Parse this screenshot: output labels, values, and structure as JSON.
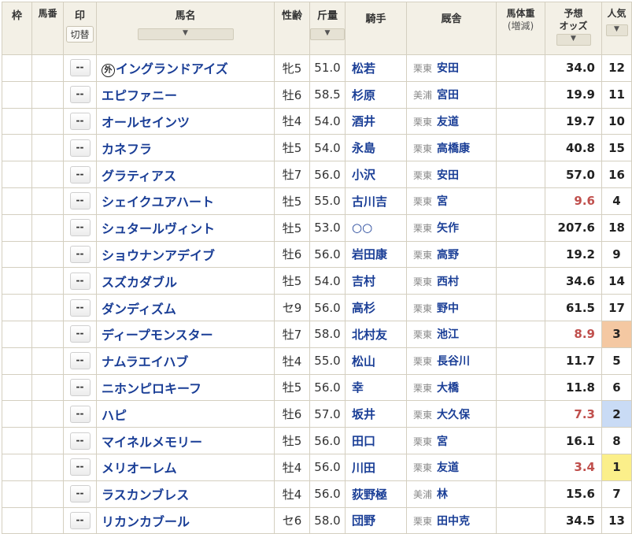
{
  "header": {
    "waku": "枠",
    "umaban": "馬番",
    "mark": "印",
    "mark_toggle": "切替",
    "horse_name": "馬名",
    "sex_age": "性齢",
    "weight": "斤量",
    "jockey": "騎手",
    "stable": "厩舎",
    "body_weight": "馬体重",
    "body_weight_sub": "(増減)",
    "odds_line1": "予想",
    "odds_line2": "オッズ",
    "popularity": "人気",
    "sort_icon": "▼"
  },
  "colors": {
    "header_bg": "#f3f0e6",
    "border": "#d4cfc0",
    "link_blue": "#1a3e96",
    "odds_hot": "#c0504d",
    "pop1_bg": "#fbef8a",
    "pop2_bg": "#c9dbf5",
    "pop3_bg": "#f4c8a2"
  },
  "rows": [
    {
      "mark": "--",
      "foreign": "外",
      "name": "イングランドアイズ",
      "sex_age": "牝5",
      "weight": "51.0",
      "jockey": "松若",
      "region": "栗東",
      "trainer": "安田",
      "odds": "34.0",
      "pop": "12"
    },
    {
      "mark": "--",
      "foreign": "",
      "name": "エピファニー",
      "sex_age": "牡6",
      "weight": "58.5",
      "jockey": "杉原",
      "region": "美浦",
      "trainer": "宮田",
      "odds": "19.9",
      "pop": "11"
    },
    {
      "mark": "--",
      "foreign": "",
      "name": "オールセインツ",
      "sex_age": "牡4",
      "weight": "54.0",
      "jockey": "酒井",
      "region": "栗東",
      "trainer": "友道",
      "odds": "19.7",
      "pop": "10"
    },
    {
      "mark": "--",
      "foreign": "",
      "name": "カネフラ",
      "sex_age": "牡5",
      "weight": "54.0",
      "jockey": "永島",
      "region": "栗東",
      "trainer": "高橋康",
      "odds": "40.8",
      "pop": "15"
    },
    {
      "mark": "--",
      "foreign": "",
      "name": "グラティアス",
      "sex_age": "牡7",
      "weight": "56.0",
      "jockey": "小沢",
      "region": "栗東",
      "trainer": "安田",
      "odds": "57.0",
      "pop": "16"
    },
    {
      "mark": "--",
      "foreign": "",
      "name": "シェイクユアハート",
      "sex_age": "牡5",
      "weight": "55.0",
      "jockey": "古川吉",
      "region": "栗東",
      "trainer": "宮",
      "odds": "9.6",
      "pop": "4",
      "hot": true
    },
    {
      "mark": "--",
      "foreign": "",
      "name": "シュタールヴィント",
      "sex_age": "牡5",
      "weight": "53.0",
      "jockey": "○○",
      "region": "栗東",
      "trainer": "矢作",
      "odds": "207.6",
      "pop": "18"
    },
    {
      "mark": "--",
      "foreign": "",
      "name": "ショウナンアデイブ",
      "sex_age": "牡6",
      "weight": "56.0",
      "jockey": "岩田康",
      "region": "栗東",
      "trainer": "高野",
      "odds": "19.2",
      "pop": "9"
    },
    {
      "mark": "--",
      "foreign": "",
      "name": "スズカダブル",
      "sex_age": "牡5",
      "weight": "54.0",
      "jockey": "吉村",
      "region": "栗東",
      "trainer": "西村",
      "odds": "34.6",
      "pop": "14"
    },
    {
      "mark": "--",
      "foreign": "",
      "name": "ダンディズム",
      "sex_age": "セ9",
      "weight": "56.0",
      "jockey": "高杉",
      "region": "栗東",
      "trainer": "野中",
      "odds": "61.5",
      "pop": "17"
    },
    {
      "mark": "--",
      "foreign": "",
      "name": "ディープモンスター",
      "sex_age": "牡7",
      "weight": "58.0",
      "jockey": "北村友",
      "region": "栗東",
      "trainer": "池江",
      "odds": "8.9",
      "pop": "3",
      "hot": true,
      "pop_rank": 3
    },
    {
      "mark": "--",
      "foreign": "",
      "name": "ナムラエイハブ",
      "sex_age": "牡4",
      "weight": "55.0",
      "jockey": "松山",
      "region": "栗東",
      "trainer": "長谷川",
      "odds": "11.7",
      "pop": "5"
    },
    {
      "mark": "--",
      "foreign": "",
      "name": "ニホンピロキーフ",
      "sex_age": "牡5",
      "weight": "56.0",
      "jockey": "幸",
      "region": "栗東",
      "trainer": "大橋",
      "odds": "11.8",
      "pop": "6"
    },
    {
      "mark": "--",
      "foreign": "",
      "name": "ハピ",
      "sex_age": "牡6",
      "weight": "57.0",
      "jockey": "坂井",
      "region": "栗東",
      "trainer": "大久保",
      "odds": "7.3",
      "pop": "2",
      "hot": true,
      "pop_rank": 2
    },
    {
      "mark": "--",
      "foreign": "",
      "name": "マイネルメモリー",
      "sex_age": "牡5",
      "weight": "56.0",
      "jockey": "田口",
      "region": "栗東",
      "trainer": "宮",
      "odds": "16.1",
      "pop": "8"
    },
    {
      "mark": "--",
      "foreign": "",
      "name": "メリオーレム",
      "sex_age": "牡4",
      "weight": "56.0",
      "jockey": "川田",
      "region": "栗東",
      "trainer": "友道",
      "odds": "3.4",
      "pop": "1",
      "hot": true,
      "pop_rank": 1
    },
    {
      "mark": "--",
      "foreign": "",
      "name": "ラスカンブレス",
      "sex_age": "牡4",
      "weight": "56.0",
      "jockey": "荻野極",
      "region": "美浦",
      "trainer": "林",
      "odds": "15.6",
      "pop": "7"
    },
    {
      "mark": "--",
      "foreign": "",
      "name": "リカンカブール",
      "sex_age": "セ6",
      "weight": "58.0",
      "jockey": "団野",
      "region": "栗東",
      "trainer": "田中克",
      "odds": "34.5",
      "pop": "13"
    }
  ]
}
